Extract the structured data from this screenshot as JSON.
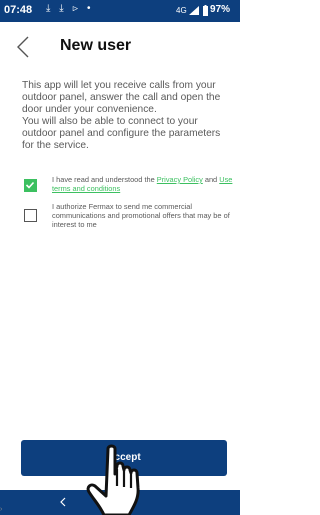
{
  "status_bar": {
    "time": "07:48",
    "notification_icons": "⤓ ⤓ ⊳ •",
    "network": "4G",
    "battery": "97%"
  },
  "header": {
    "title": "New user",
    "back_icon": "chevron-left"
  },
  "intro": {
    "paragraph1": "This app will let you receive calls from your outdoor panel, answer the call and open the door under your convenience.",
    "paragraph2": "You will also be able to connect to your outdoor panel and configure the parameters for the service."
  },
  "consents": {
    "privacy": {
      "checked": true,
      "text_before": "I have read and understood the ",
      "link1": "Privacy Policy",
      "text_middle": " and ",
      "link2": "Use terms and conditions"
    },
    "marketing": {
      "checked": false,
      "text": "I authorize Fermax to send me commercial communications and promotional offers that may be of interest to me"
    }
  },
  "accept_label": "Accept",
  "nav": {
    "back_label": "<"
  },
  "edge_glyph": "›",
  "colors": {
    "brand": "#0d3f7e",
    "accent": "#3cc060",
    "text": "#5a5a5a"
  }
}
